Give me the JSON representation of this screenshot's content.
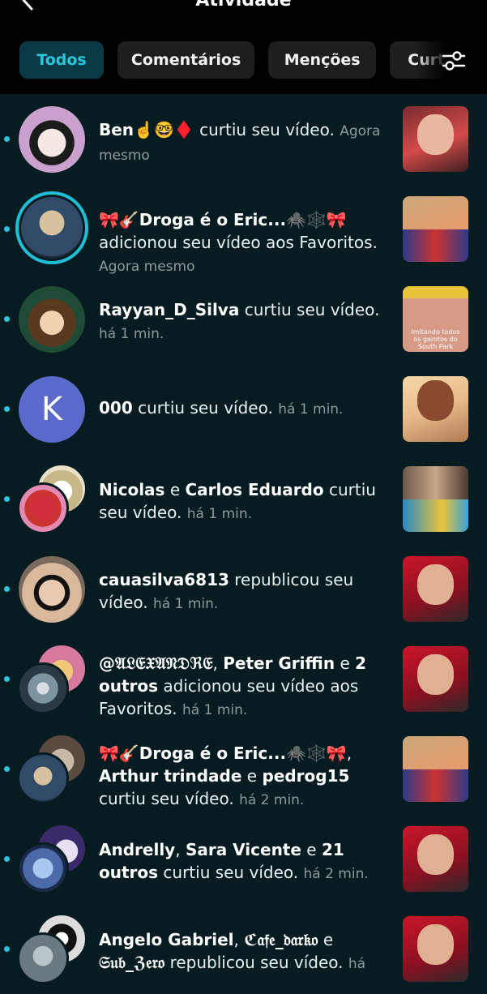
{
  "header": {
    "title": "Atividade"
  },
  "tabs": [
    {
      "label": "Todos",
      "active": true
    },
    {
      "label": "Comentários"
    },
    {
      "label": "Menções"
    },
    {
      "label": "Curti"
    }
  ],
  "icons": {
    "back": "chevron-left-icon",
    "filter": "sliders-icon"
  },
  "colors": {
    "accent": "#2bc6dc",
    "background": "#061c20",
    "tab_active_bg": "#0b3a44"
  },
  "notifications": [
    {
      "name": "Ben☝️🤓♦️",
      "action": "curtiu seu vídeo.",
      "time": "Agora mesmo"
    },
    {
      "name": "🎀🎸Droga é o Eric...🕷️🕸️🎀",
      "action": "adicionou seu vídeo aos Favoritos.",
      "time": "Agora mesmo"
    },
    {
      "name": "Rayyan_D_Silva",
      "action": "curtiu seu vídeo.",
      "time": "há 1 min.",
      "thumb_caption": "Imitando todos os garotos do South Park"
    },
    {
      "name": "000",
      "action": "curtiu seu vídeo.",
      "time": "há 1 min.",
      "avatar_letter": "K"
    },
    {
      "name1": "Nicolas",
      "joiner": "e",
      "name2": "Carlos Eduardo",
      "action": "curtiu seu vídeo.",
      "time": "há 1 min."
    },
    {
      "name": "cauasilva6813",
      "action": "republicou seu vídeo.",
      "time": "há 1 min."
    },
    {
      "name1": "@𝔄𝔏𝔈𝔛𝔄𝔑𝔇ℜ𝔈",
      "sep": ",",
      "name2": "Peter Griffin",
      "joiner": "e",
      "name3": "2 outros",
      "action": "adicionou seu vídeo aos Favoritos.",
      "time": "há 1 min."
    },
    {
      "name1": "🎀🎸Droga é o Eric...🕷️🕸️🎀",
      "sep": ",",
      "name2": "Arthur trindade",
      "joiner": "e",
      "name3": "pedrog15",
      "action": "curtiu seu vídeo.",
      "time": "há 2 min."
    },
    {
      "name1": "Andrelly",
      "sep": ",",
      "name2": "Sara Vicente",
      "joiner": "e",
      "name3": "21 outros",
      "action": "curtiu seu vídeo.",
      "time": "há 2 min."
    },
    {
      "name1": "Angelo Gabriel",
      "sep": ",",
      "name2": "ℭ𝔞𝔣𝔢_𝔡𝔞𝔯𝔨𝔬",
      "joiner": "e",
      "name3": "𝔖𝔲𝔟_ℨ𝔢𝔯𝔬",
      "action": "republicou seu vídeo.",
      "time": "há"
    }
  ]
}
